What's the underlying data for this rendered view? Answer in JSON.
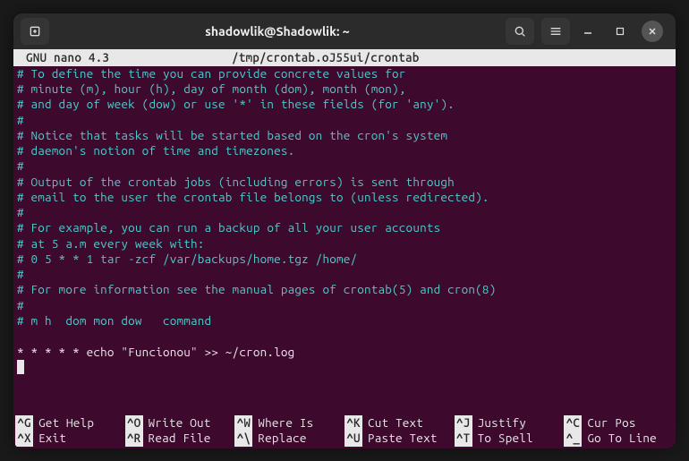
{
  "window": {
    "title": "shadowlik@Shadowlik: ~"
  },
  "editor": {
    "app": "GNU nano 4.3",
    "file": "/tmp/crontab.oJ55ui/crontab"
  },
  "lines": [
    {
      "t": "c",
      "v": "# To define the time you can provide concrete values for"
    },
    {
      "t": "c",
      "v": "# minute (m), hour (h), day of month (dom), month (mon),"
    },
    {
      "t": "c",
      "v": "# and day of week (dow) or use '*' in these fields (for 'any')."
    },
    {
      "t": "c",
      "v": "#"
    },
    {
      "t": "c",
      "v": "# Notice that tasks will be started based on the cron's system"
    },
    {
      "t": "c",
      "v": "# daemon's notion of time and timezones."
    },
    {
      "t": "c",
      "v": "#"
    },
    {
      "t": "c",
      "v": "# Output of the crontab jobs (including errors) is sent through"
    },
    {
      "t": "c",
      "v": "# email to the user the crontab file belongs to (unless redirected)."
    },
    {
      "t": "c",
      "v": "#"
    },
    {
      "t": "c",
      "v": "# For example, you can run a backup of all your user accounts"
    },
    {
      "t": "c",
      "v": "# at 5 a.m every week with:"
    },
    {
      "t": "c",
      "v": "# 0 5 * * 1 tar -zcf /var/backups/home.tgz /home/"
    },
    {
      "t": "c",
      "v": "#"
    },
    {
      "t": "c",
      "v": "# For more information see the manual pages of crontab(5) and cron(8)"
    },
    {
      "t": "c",
      "v": "#"
    },
    {
      "t": "c",
      "v": "# m h  dom mon dow   command"
    },
    {
      "t": "p",
      "v": ""
    },
    {
      "t": "p",
      "v": "* * * * * echo \"Funcionou\" >> ~/cron.log"
    }
  ],
  "shortcuts": [
    {
      "key": "^G",
      "label": "Get Help"
    },
    {
      "key": "^O",
      "label": "Write Out"
    },
    {
      "key": "^W",
      "label": "Where Is"
    },
    {
      "key": "^K",
      "label": "Cut Text"
    },
    {
      "key": "^J",
      "label": "Justify"
    },
    {
      "key": "^C",
      "label": "Cur Pos"
    },
    {
      "key": "^X",
      "label": "Exit"
    },
    {
      "key": "^R",
      "label": "Read File"
    },
    {
      "key": "^\\",
      "label": "Replace"
    },
    {
      "key": "^U",
      "label": "Paste Text"
    },
    {
      "key": "^T",
      "label": "To Spell"
    },
    {
      "key": "^_",
      "label": "Go To Line"
    }
  ]
}
